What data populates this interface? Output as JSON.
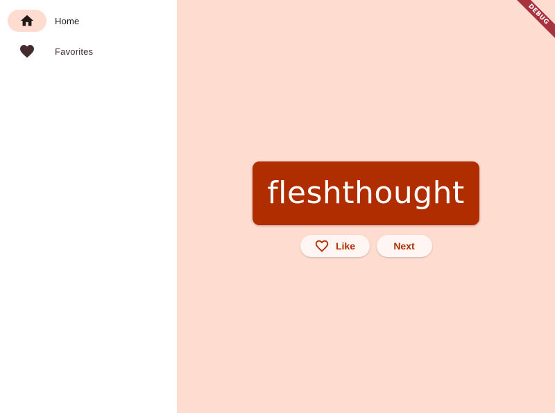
{
  "nav": {
    "items": [
      {
        "label": "Home",
        "icon": "home-icon",
        "selected": true
      },
      {
        "label": "Favorites",
        "icon": "heart-icon",
        "selected": false
      }
    ]
  },
  "main": {
    "word": "fleshthought",
    "like_label": "Like",
    "next_label": "Next"
  },
  "debug_banner": "DEBUG",
  "colors": {
    "primary": "#b02d00",
    "background": "#ffdbd0",
    "button_bg": "#fff5f2",
    "indicator": "#ffdbd0"
  }
}
